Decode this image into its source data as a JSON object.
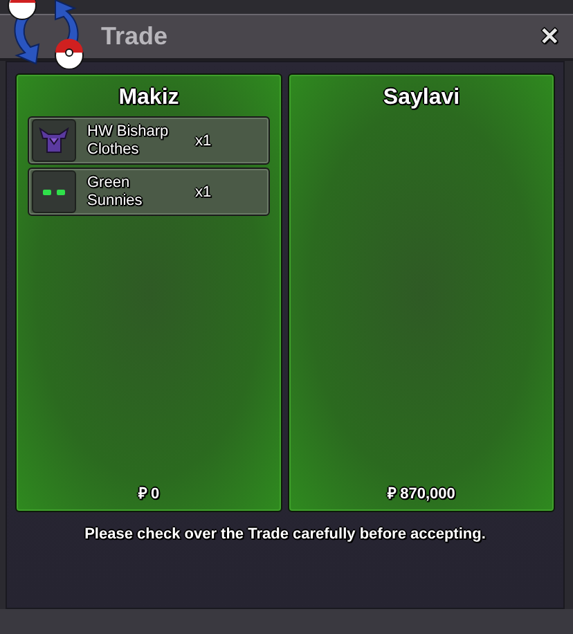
{
  "window": {
    "title": "Trade",
    "close": "✕"
  },
  "panels": [
    {
      "name": "Makiz",
      "money": "₽ 0",
      "items": [
        {
          "kind": "clothes",
          "name": "HW Bisharp Clothes",
          "quantity": "x1"
        },
        {
          "kind": "sunnies",
          "name": "Green Sunnies",
          "quantity": "x1"
        }
      ]
    },
    {
      "name": "Saylavi",
      "money": "₽ 870,000"
    }
  ],
  "notice": "Please check over the Trade carefully before accepting."
}
